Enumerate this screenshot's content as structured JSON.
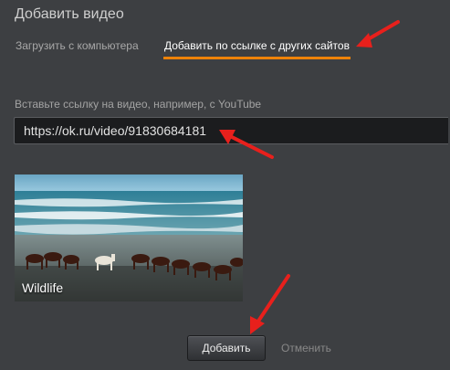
{
  "dialog": {
    "title": "Добавить видео",
    "tabs": [
      {
        "label": "Загрузить с компьютера",
        "active": false
      },
      {
        "label": "Добавить по ссылке с других сайтов",
        "active": true
      }
    ],
    "url_label": "Вставьте ссылку на видео, например, с YouTube",
    "url_value": "https://ok.ru/video/91830684181",
    "preview": {
      "caption": "Wildlife"
    },
    "add_button": "Добавить",
    "cancel_link": "Отменить"
  },
  "colors": {
    "background": "#3d3f42",
    "accent": "#ee8209",
    "annotation_arrow": "#e8201c",
    "input_background": "#1b1c1e"
  },
  "annotations": {
    "arrow_icons": [
      "red-arrow-icon",
      "red-arrow-icon",
      "red-arrow-icon"
    ]
  }
}
